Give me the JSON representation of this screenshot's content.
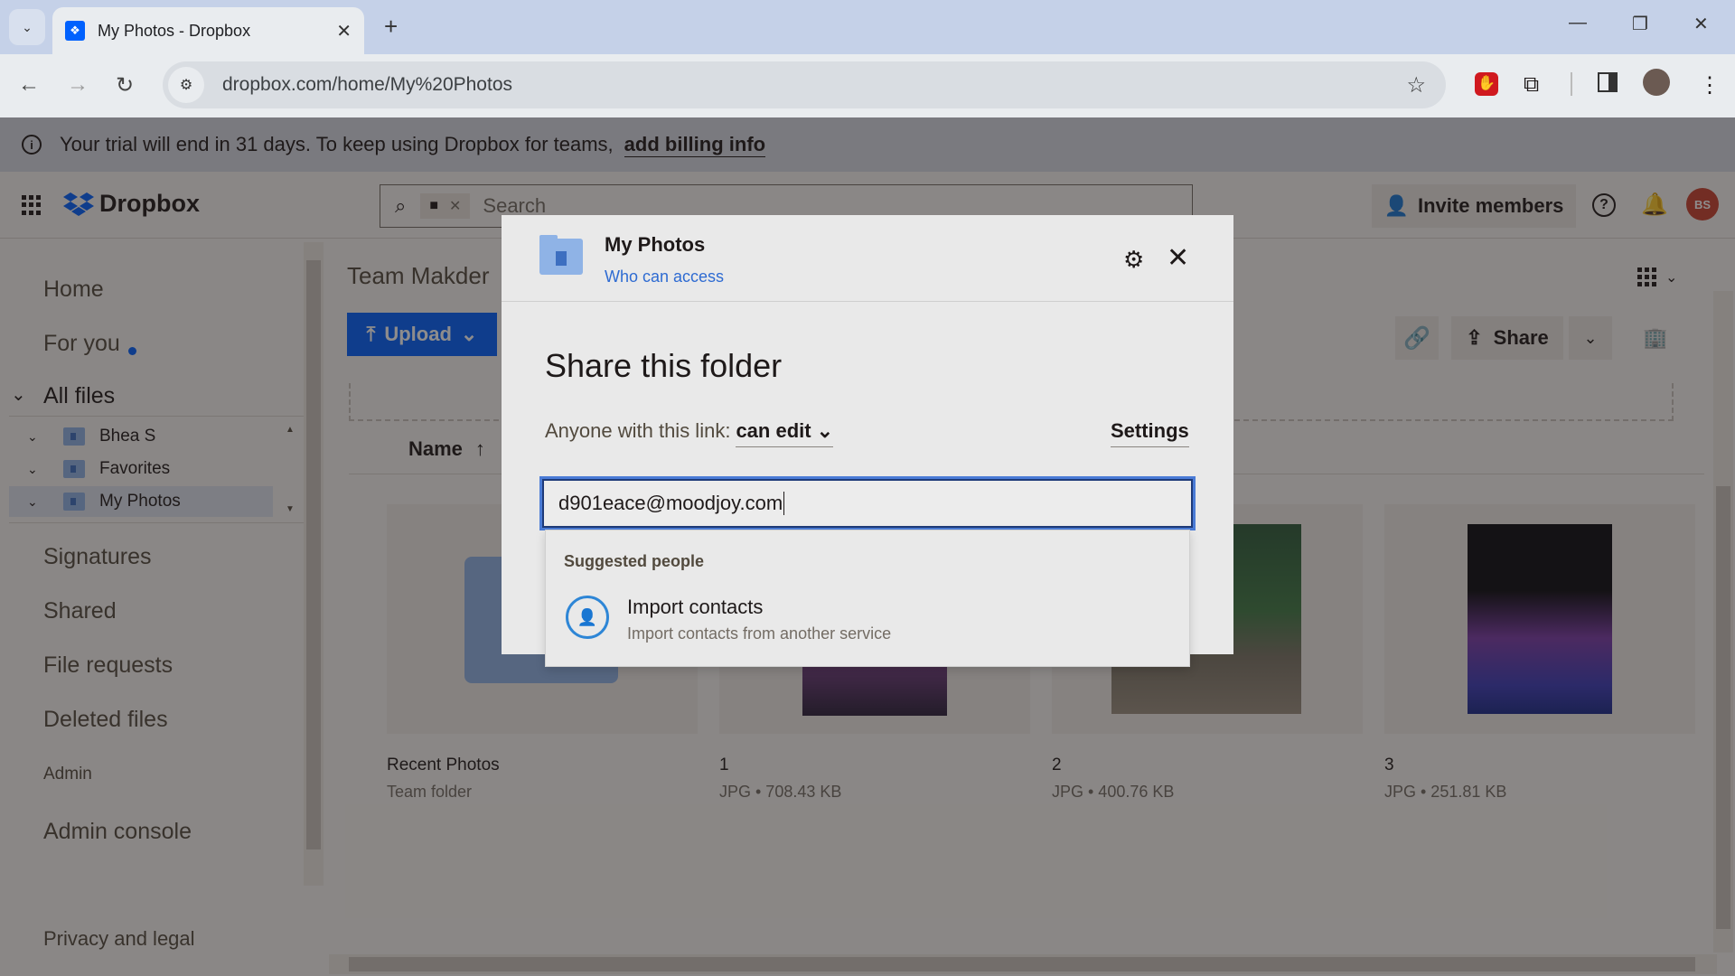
{
  "browser": {
    "tab_title": "My Photos - Dropbox",
    "url": "dropbox.com/home/My%20Photos",
    "new_tab_glyph": "+",
    "close_tab_glyph": "✕"
  },
  "banner": {
    "message": "Your trial will end in 31 days. To keep using Dropbox for teams,",
    "link": "add billing info"
  },
  "topbar": {
    "logo_text": "Dropbox",
    "search_placeholder": "Search",
    "invite_label": "Invite members",
    "avatar_initials": "BS"
  },
  "sidebar": {
    "items": [
      {
        "label": "Home"
      },
      {
        "label": "For you"
      },
      {
        "label": "All files"
      }
    ],
    "tree": [
      {
        "label": "Bhea S"
      },
      {
        "label": "Favorites"
      },
      {
        "label": "My Photos",
        "selected": true
      }
    ],
    "items_lower": [
      {
        "label": "Signatures"
      },
      {
        "label": "Shared"
      },
      {
        "label": "File requests"
      },
      {
        "label": "Deleted files"
      }
    ],
    "admin_heading": "Admin",
    "admin_console": "Admin console",
    "privacy": "Privacy and legal"
  },
  "main": {
    "title": "Team Makder",
    "upload_label": "Upload",
    "share_label": "Share",
    "sort_column": "Name",
    "items": [
      {
        "name": "Recent Photos",
        "meta": "Team folder",
        "type": "folder"
      },
      {
        "name": "1",
        "meta": "JPG • 708.43 KB",
        "type": "image"
      },
      {
        "name": "2",
        "meta": "JPG • 400.76 KB",
        "type": "image"
      },
      {
        "name": "3",
        "meta": "JPG • 251.81 KB",
        "type": "image"
      }
    ]
  },
  "modal": {
    "folder_name": "My Photos",
    "who_can_access": "Who can access",
    "heading": "Share this folder",
    "link_prefix": "Anyone with this link:",
    "link_permission": "can edit",
    "settings_label": "Settings",
    "email_value": "d901eace@moodjoy.com"
  },
  "suggestions": {
    "heading": "Suggested people",
    "items": [
      {
        "title": "Import contacts",
        "subtitle": "Import contacts from another service"
      }
    ]
  },
  "colors": {
    "brand": "#0061fe",
    "link": "#2e6bd2",
    "avatar": "#c8412f"
  }
}
